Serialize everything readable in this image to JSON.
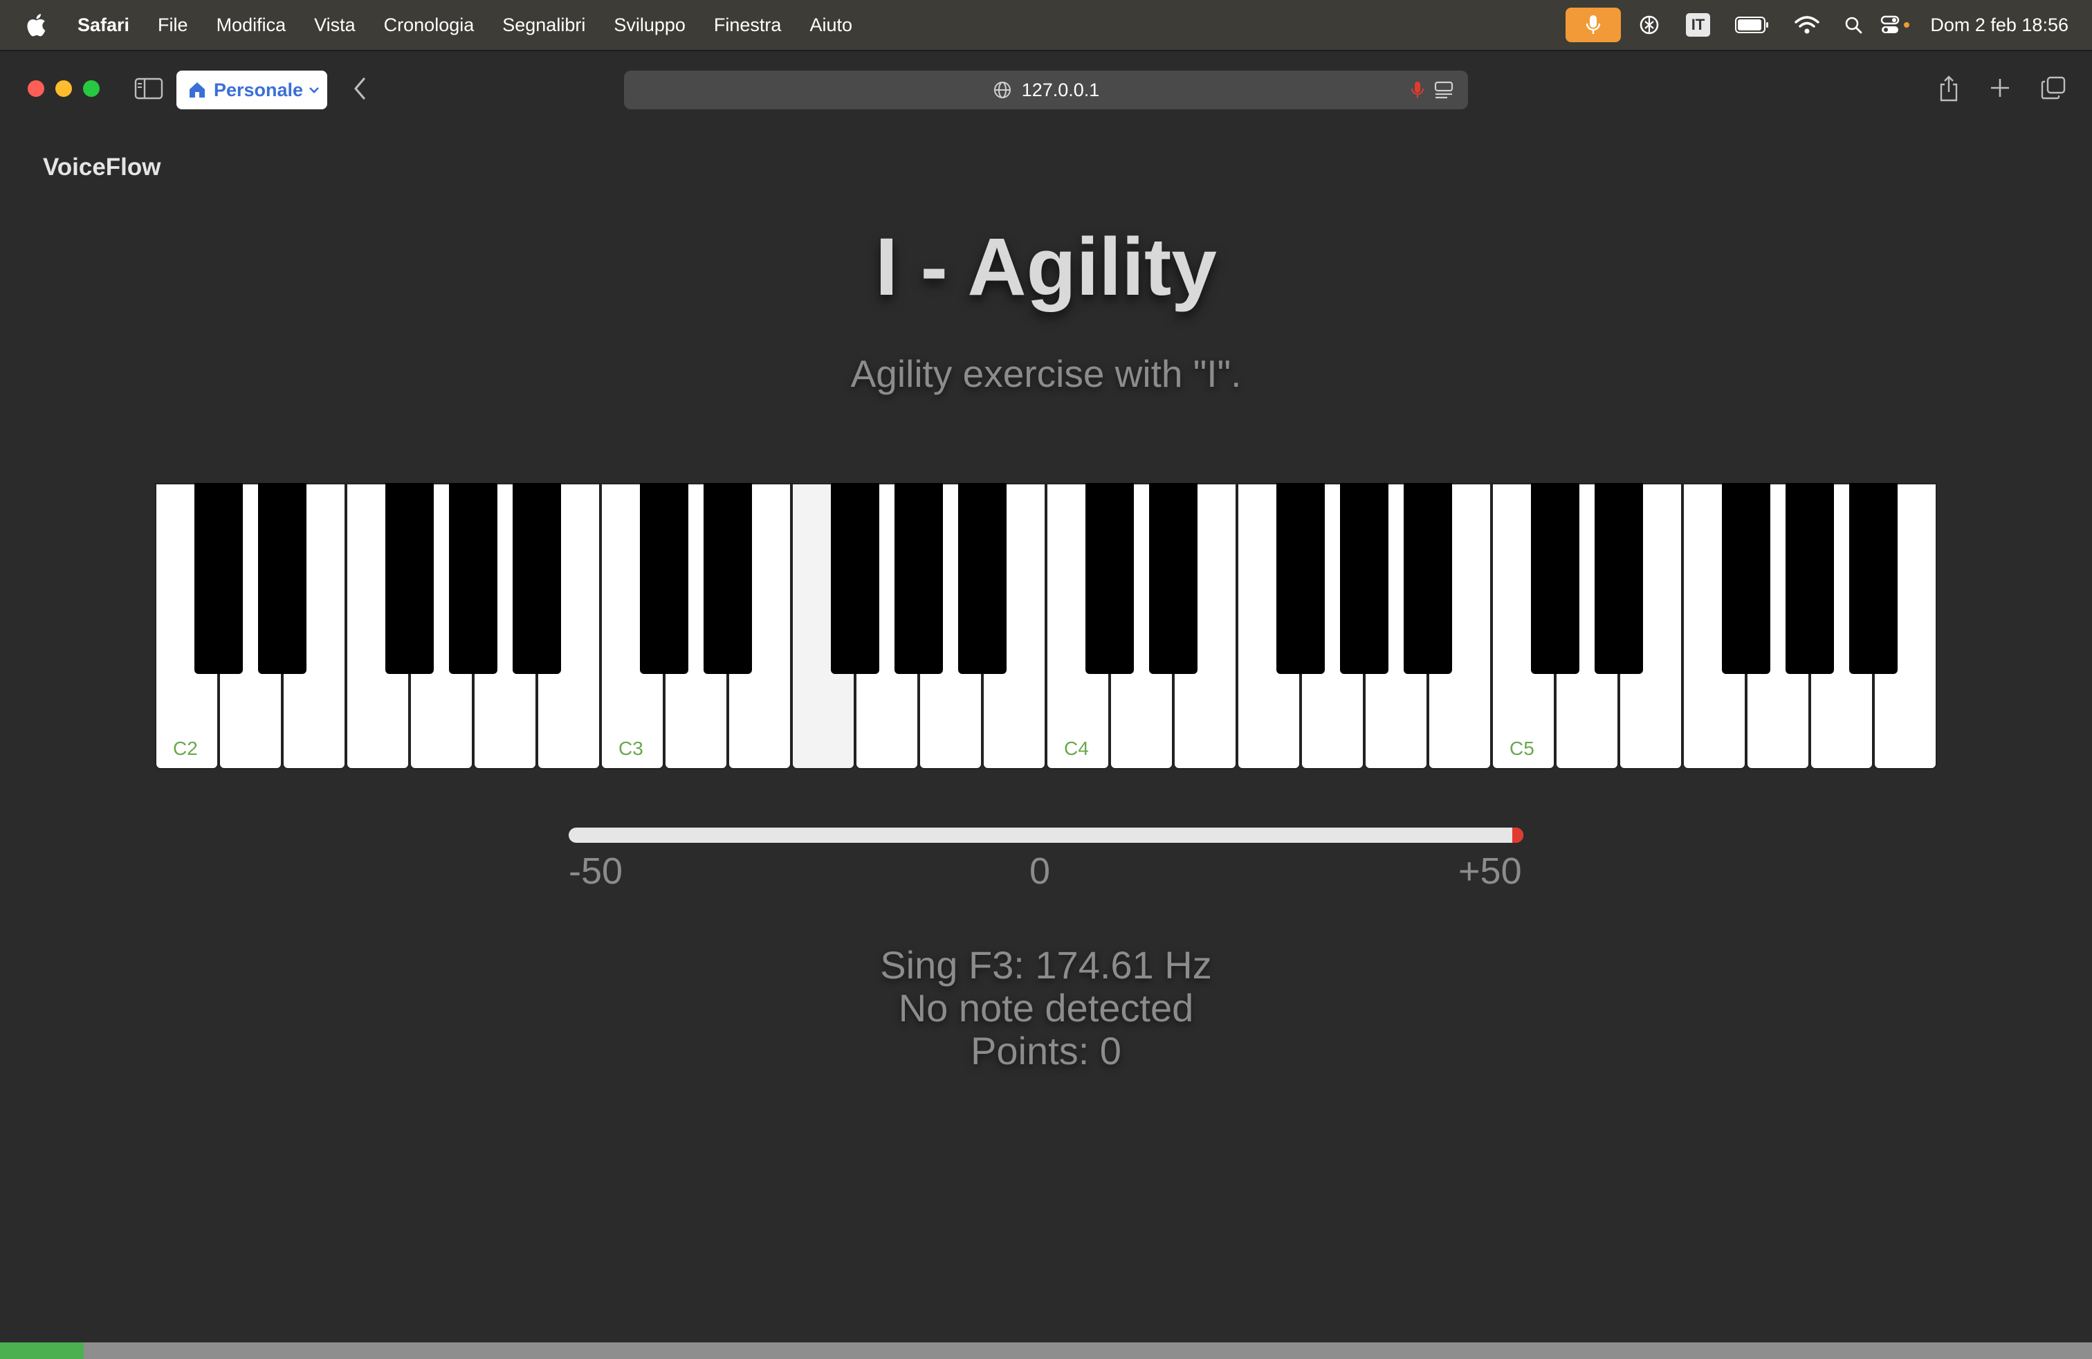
{
  "menubar": {
    "app_name": "Safari",
    "items": [
      "File",
      "Modifica",
      "Vista",
      "Cronologia",
      "Segnalibri",
      "Sviluppo",
      "Finestra",
      "Aiuto"
    ],
    "input_source": "IT",
    "datetime": "Dom 2 feb  18:56"
  },
  "toolbar": {
    "profile": "Personale",
    "url": "127.0.0.1"
  },
  "page": {
    "logo": "VoiceFlow",
    "title": "I - Agility",
    "subtitle": "Agility exercise with \"I\".",
    "piano": {
      "octave_labels": [
        "C2",
        "C3",
        "C4",
        "C5"
      ],
      "white_key_count": 28,
      "highlighted_key": "F3"
    },
    "meter": {
      "min_label": "-50",
      "mid_label": "0",
      "max_label": "+50",
      "current_cents": 50
    },
    "status": {
      "target": "Sing F3: 174.61 Hz",
      "detection": "No note detected",
      "points": "Points: 0"
    },
    "progress_fraction": 0.04
  },
  "colors": {
    "accent_mic": "#f19a37",
    "note_label": "#6aa84f",
    "meter_marker": "#e23a2e",
    "progress": "#4caf50"
  }
}
